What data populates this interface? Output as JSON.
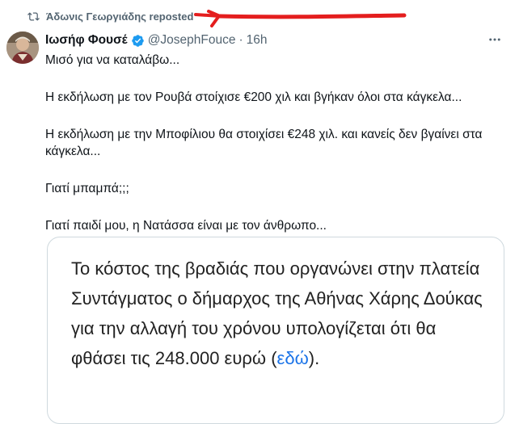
{
  "repost": {
    "label": "Άδωνις Γεωργιάδης reposted",
    "icon": "repost-icon"
  },
  "tweet": {
    "author_name": "Ιωσήφ Φουσέ",
    "handle": "@JosephFouce",
    "separator": "·",
    "time": "16h",
    "verified_icon": "verified-badge-icon",
    "more_icon": "more-options-icon",
    "lines": [
      "Μισό για να καταλάβω...",
      "Η εκδήλωση με τον Ρουβά στοίχισε €200 χιλ και βγήκαν όλοι στα κάγκελα...",
      "Η εκδήλωση με την Μποφίλιου θα στοιχίσει €248 χιλ. και κανείς δεν βγαίνει στα κάγκελα...",
      "Γιατί μπαμπά;;;",
      "Γιατί παιδί μου, η Νατάσσα είναι με τον άνθρωπο..."
    ]
  },
  "quote": {
    "text": "Το κόστος της βραδιάς που οργανώνει στην πλατεία Συντάγματος ο δήμαρχος της Αθήνας Χάρης Δούκας για την αλλαγή του χρόνου υπολογίζεται ότι θα φθάσει τις 248.000 ευρώ",
    "open_paren": " (",
    "link": "εδώ",
    "close": ")."
  },
  "colors": {
    "muted": "#536471",
    "verified": "#1d9bf0",
    "annotation": "#e41e1e",
    "link": "#1a73e8"
  }
}
